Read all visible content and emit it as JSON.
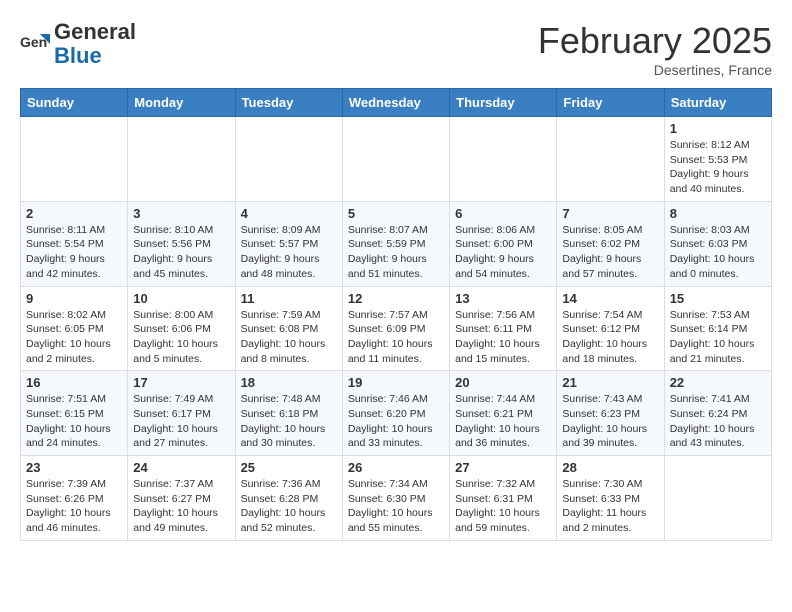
{
  "header": {
    "logo_line1": "General",
    "logo_line2": "Blue",
    "month": "February 2025",
    "location": "Desertines, France"
  },
  "weekdays": [
    "Sunday",
    "Monday",
    "Tuesday",
    "Wednesday",
    "Thursday",
    "Friday",
    "Saturday"
  ],
  "weeks": [
    [
      {
        "day": "",
        "info": ""
      },
      {
        "day": "",
        "info": ""
      },
      {
        "day": "",
        "info": ""
      },
      {
        "day": "",
        "info": ""
      },
      {
        "day": "",
        "info": ""
      },
      {
        "day": "",
        "info": ""
      },
      {
        "day": "1",
        "info": "Sunrise: 8:12 AM\nSunset: 5:53 PM\nDaylight: 9 hours and 40 minutes."
      }
    ],
    [
      {
        "day": "2",
        "info": "Sunrise: 8:11 AM\nSunset: 5:54 PM\nDaylight: 9 hours and 42 minutes."
      },
      {
        "day": "3",
        "info": "Sunrise: 8:10 AM\nSunset: 5:56 PM\nDaylight: 9 hours and 45 minutes."
      },
      {
        "day": "4",
        "info": "Sunrise: 8:09 AM\nSunset: 5:57 PM\nDaylight: 9 hours and 48 minutes."
      },
      {
        "day": "5",
        "info": "Sunrise: 8:07 AM\nSunset: 5:59 PM\nDaylight: 9 hours and 51 minutes."
      },
      {
        "day": "6",
        "info": "Sunrise: 8:06 AM\nSunset: 6:00 PM\nDaylight: 9 hours and 54 minutes."
      },
      {
        "day": "7",
        "info": "Sunrise: 8:05 AM\nSunset: 6:02 PM\nDaylight: 9 hours and 57 minutes."
      },
      {
        "day": "8",
        "info": "Sunrise: 8:03 AM\nSunset: 6:03 PM\nDaylight: 10 hours and 0 minutes."
      }
    ],
    [
      {
        "day": "9",
        "info": "Sunrise: 8:02 AM\nSunset: 6:05 PM\nDaylight: 10 hours and 2 minutes."
      },
      {
        "day": "10",
        "info": "Sunrise: 8:00 AM\nSunset: 6:06 PM\nDaylight: 10 hours and 5 minutes."
      },
      {
        "day": "11",
        "info": "Sunrise: 7:59 AM\nSunset: 6:08 PM\nDaylight: 10 hours and 8 minutes."
      },
      {
        "day": "12",
        "info": "Sunrise: 7:57 AM\nSunset: 6:09 PM\nDaylight: 10 hours and 11 minutes."
      },
      {
        "day": "13",
        "info": "Sunrise: 7:56 AM\nSunset: 6:11 PM\nDaylight: 10 hours and 15 minutes."
      },
      {
        "day": "14",
        "info": "Sunrise: 7:54 AM\nSunset: 6:12 PM\nDaylight: 10 hours and 18 minutes."
      },
      {
        "day": "15",
        "info": "Sunrise: 7:53 AM\nSunset: 6:14 PM\nDaylight: 10 hours and 21 minutes."
      }
    ],
    [
      {
        "day": "16",
        "info": "Sunrise: 7:51 AM\nSunset: 6:15 PM\nDaylight: 10 hours and 24 minutes."
      },
      {
        "day": "17",
        "info": "Sunrise: 7:49 AM\nSunset: 6:17 PM\nDaylight: 10 hours and 27 minutes."
      },
      {
        "day": "18",
        "info": "Sunrise: 7:48 AM\nSunset: 6:18 PM\nDaylight: 10 hours and 30 minutes."
      },
      {
        "day": "19",
        "info": "Sunrise: 7:46 AM\nSunset: 6:20 PM\nDaylight: 10 hours and 33 minutes."
      },
      {
        "day": "20",
        "info": "Sunrise: 7:44 AM\nSunset: 6:21 PM\nDaylight: 10 hours and 36 minutes."
      },
      {
        "day": "21",
        "info": "Sunrise: 7:43 AM\nSunset: 6:23 PM\nDaylight: 10 hours and 39 minutes."
      },
      {
        "day": "22",
        "info": "Sunrise: 7:41 AM\nSunset: 6:24 PM\nDaylight: 10 hours and 43 minutes."
      }
    ],
    [
      {
        "day": "23",
        "info": "Sunrise: 7:39 AM\nSunset: 6:26 PM\nDaylight: 10 hours and 46 minutes."
      },
      {
        "day": "24",
        "info": "Sunrise: 7:37 AM\nSunset: 6:27 PM\nDaylight: 10 hours and 49 minutes."
      },
      {
        "day": "25",
        "info": "Sunrise: 7:36 AM\nSunset: 6:28 PM\nDaylight: 10 hours and 52 minutes."
      },
      {
        "day": "26",
        "info": "Sunrise: 7:34 AM\nSunset: 6:30 PM\nDaylight: 10 hours and 55 minutes."
      },
      {
        "day": "27",
        "info": "Sunrise: 7:32 AM\nSunset: 6:31 PM\nDaylight: 10 hours and 59 minutes."
      },
      {
        "day": "28",
        "info": "Sunrise: 7:30 AM\nSunset: 6:33 PM\nDaylight: 11 hours and 2 minutes."
      },
      {
        "day": "",
        "info": ""
      }
    ]
  ]
}
